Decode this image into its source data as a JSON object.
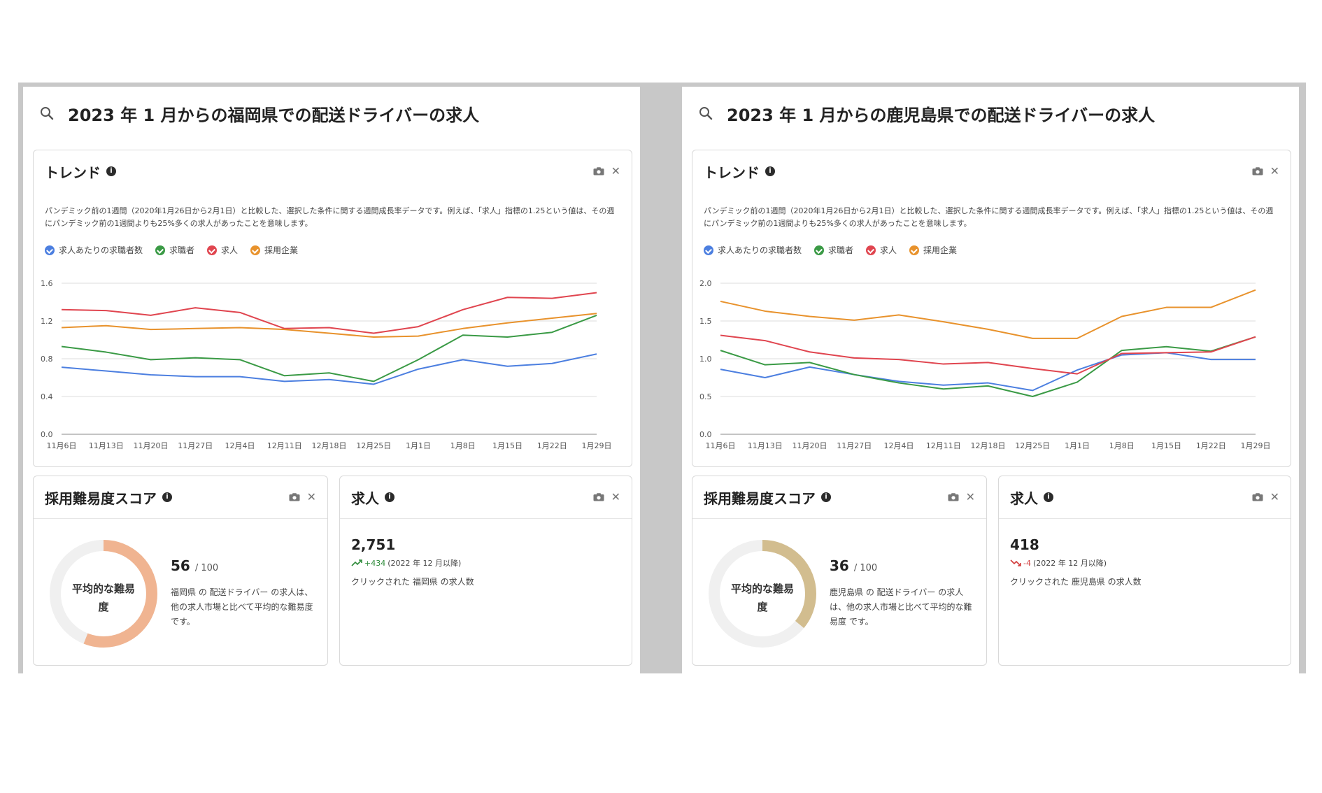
{
  "left": {
    "search_title": "2023 年 1 月からの福岡県での配送ドライバーの求人",
    "trend": {
      "title": "トレンド",
      "description": "パンデミック前の1週間（2020年1月26日から2月1日）と比較した、選択した条件に関する週間成長率データです。例えば、「求人」指標の1.25という値は、その週にパンデミック前の1週間よりも25%多くの求人があったことを意味します。",
      "legend": [
        "求人あたりの求職者数",
        "求職者",
        "求人",
        "採用企業"
      ]
    },
    "score": {
      "title": "採用難易度スコア",
      "donut_label": "平均的な難易度",
      "value": "56",
      "max": "/ 100",
      "description": "福岡県 の 配送ドライバー の求人は、他の求人市場と比べて平均的な難易度 です。",
      "fraction": 0.56,
      "color": "#f0b491"
    },
    "jobs": {
      "title": "求人",
      "count": "2,751",
      "delta": "+434",
      "delta_direction": "up",
      "since": "(2022 年 12 月以降)",
      "description": "クリックされた 福岡県 の求人数"
    }
  },
  "right": {
    "search_title": "2023 年 1 月からの鹿児島県での配送ドライバーの求人",
    "trend": {
      "title": "トレンド",
      "description": "パンデミック前の1週間（2020年1月26日から2月1日）と比較した、選択した条件に関する週間成長率データです。例えば、「求人」指標の1.25という値は、その週にパンデミック前の1週間よりも25%多くの求人があったことを意味します。",
      "legend": [
        "求人あたりの求職者数",
        "求職者",
        "求人",
        "採用企業"
      ]
    },
    "score": {
      "title": "採用難易度スコア",
      "donut_label": "平均的な難易度",
      "value": "36",
      "max": "/ 100",
      "description": "鹿児島県 の 配送ドライバー の求人は、他の求人市場と比べて平均的な難易度 です。",
      "fraction": 0.36,
      "color": "#d2bd8f"
    },
    "jobs": {
      "title": "求人",
      "count": "418",
      "delta": "-4",
      "delta_direction": "down",
      "since": "(2022 年 12 月以降)",
      "description": "クリックされた 鹿児島県 の求人数"
    }
  },
  "colors": {
    "series": [
      "#4c7fe0",
      "#3a9a45",
      "#e0454f",
      "#e8922c"
    ],
    "grid": "#dddddd"
  },
  "chart_data": [
    {
      "type": "line",
      "title": "",
      "categories": [
        "11月6日",
        "11月13日",
        "11月20日",
        "11月27日",
        "12月4日",
        "12月11日",
        "12月18日",
        "12月25日",
        "1月1日",
        "1月8日",
        "1月15日",
        "1月22日",
        "1月29日"
      ],
      "x": [
        0,
        7,
        14,
        21,
        28,
        35,
        42,
        49,
        56,
        63,
        70,
        77,
        84
      ],
      "yticks": [
        "0.0",
        "0.4",
        "0.8",
        "1.2",
        "1.6"
      ],
      "ylim": [
        0,
        1.6
      ],
      "grid": true,
      "legend_position": "top-left",
      "series": [
        {
          "name": "求人あたりの求職者数",
          "values": [
            0.71,
            0.67,
            0.63,
            0.61,
            0.61,
            0.56,
            0.58,
            0.53,
            0.69,
            0.79,
            0.72,
            0.75,
            0.85
          ]
        },
        {
          "name": "求職者",
          "values": [
            0.93,
            0.87,
            0.79,
            0.81,
            0.79,
            0.62,
            0.65,
            0.56,
            0.79,
            1.05,
            1.03,
            1.08,
            1.26
          ]
        },
        {
          "name": "求人",
          "values": [
            1.32,
            1.31,
            1.26,
            1.34,
            1.29,
            1.12,
            1.13,
            1.07,
            1.14,
            1.32,
            1.45,
            1.44,
            1.5
          ]
        },
        {
          "name": "採用企業",
          "values": [
            1.13,
            1.15,
            1.11,
            1.12,
            1.13,
            1.11,
            1.07,
            1.03,
            1.04,
            1.12,
            1.18,
            1.23,
            1.28
          ]
        }
      ]
    },
    {
      "type": "line",
      "title": "",
      "categories": [
        "11月6日",
        "11月13日",
        "11月20日",
        "11月27日",
        "12月4日",
        "12月11日",
        "12月18日",
        "12月25日",
        "1月1日",
        "1月8日",
        "1月15日",
        "1月22日",
        "1月29日"
      ],
      "x": [
        0,
        7,
        14,
        21,
        28,
        35,
        42,
        49,
        56,
        63,
        70,
        77,
        84
      ],
      "yticks": [
        "0.0",
        "0.5",
        "1.0",
        "1.5",
        "2.0"
      ],
      "ylim": [
        0,
        2.0
      ],
      "grid": true,
      "legend_position": "top-left",
      "series": [
        {
          "name": "求人あたりの求職者数",
          "values": [
            0.86,
            0.75,
            0.89,
            0.79,
            0.7,
            0.65,
            0.68,
            0.58,
            0.85,
            1.05,
            1.08,
            0.99,
            0.99
          ]
        },
        {
          "name": "求職者",
          "values": [
            1.11,
            0.92,
            0.95,
            0.79,
            0.68,
            0.6,
            0.64,
            0.5,
            0.69,
            1.11,
            1.16,
            1.1,
            1.29
          ]
        },
        {
          "name": "求人",
          "values": [
            1.31,
            1.24,
            1.09,
            1.01,
            0.99,
            0.93,
            0.95,
            0.87,
            0.8,
            1.07,
            1.08,
            1.09,
            1.29
          ]
        },
        {
          "name": "採用企業",
          "values": [
            1.76,
            1.63,
            1.56,
            1.51,
            1.58,
            1.49,
            1.39,
            1.27,
            1.27,
            1.56,
            1.68,
            1.68,
            1.91
          ]
        }
      ]
    }
  ]
}
